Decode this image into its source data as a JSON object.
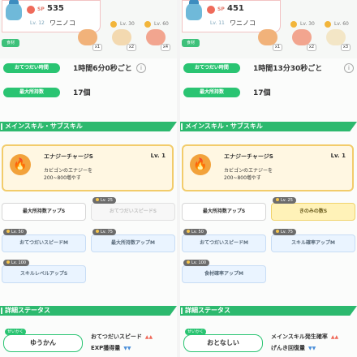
{
  "panels": [
    {
      "sp": "535",
      "sp_label": "SP",
      "level": "Lv. 12",
      "name": "ワニノコ",
      "green_tag": "食材",
      "items": [
        {
          "lv": "",
          "count": "x1",
          "color": "#f1b27a"
        },
        {
          "lv": "Lv. 30",
          "count": "x2",
          "color": "#f3d9b0"
        },
        {
          "lv": "Lv. 60",
          "count": "x4",
          "color": "#f2a58f"
        }
      ],
      "help_label": "おてつだい時間",
      "help_value": "1時間6分0秒ごと",
      "max_label": "最大所持数",
      "max_value": "17個",
      "section_skill": "メインスキル・サブスキル",
      "main_skill": {
        "name": "エナジーチャージS",
        "lv": "Lv. 1",
        "desc_1": "カビゴンのエナジーを",
        "desc_2": "200~800増やす"
      },
      "sub_skills": [
        {
          "tag": "",
          "label": "最大所持数アップS",
          "style": "white"
        },
        {
          "tag": "Lv. 25",
          "label": "おてつだいスピードS",
          "style": "gray"
        },
        {
          "tag": "Lv. 50",
          "label": "おてつだいスピードM",
          "style": "blue"
        },
        {
          "tag": "Lv. 75",
          "label": "最大所持数アップM",
          "style": "blue"
        },
        {
          "tag": "Lv. 100",
          "label": "スキルレベルアップS",
          "style": "blue"
        }
      ],
      "section_stats": "詳細ステータス",
      "personality_tag": "せいかく",
      "personality": "ゆうかん",
      "stats": [
        {
          "label": "おてつだいスピード",
          "arrow": "▲▲",
          "dir": "up"
        },
        {
          "label": "EXP獲得量",
          "arrow": "▼▼",
          "dir": "down"
        }
      ]
    },
    {
      "sp": "451",
      "sp_label": "SP",
      "level": "Lv. 11",
      "name": "ワニノコ",
      "green_tag": "食材",
      "items": [
        {
          "lv": "",
          "count": "x1",
          "color": "#f1b27a"
        },
        {
          "lv": "Lv. 30",
          "count": "x2",
          "color": "#f2a58f"
        },
        {
          "lv": "Lv. 60",
          "count": "x3",
          "color": "#f3e6c6"
        }
      ],
      "help_label": "おてつだい時間",
      "help_value": "1時間13分30秒ごと",
      "max_label": "最大所持数",
      "max_value": "17個",
      "section_skill": "メインスキル・サブスキル",
      "main_skill": {
        "name": "エナジーチャージS",
        "lv": "Lv. 1",
        "desc_1": "カビゴンのエナジーを",
        "desc_2": "200~800増やす"
      },
      "sub_skills": [
        {
          "tag": "",
          "label": "最大所持数アップS",
          "style": "white"
        },
        {
          "tag": "Lv. 25",
          "label": "きのみの数S",
          "style": "yellow"
        },
        {
          "tag": "Lv. 50",
          "label": "おてつだいスピードM",
          "style": "blue"
        },
        {
          "tag": "Lv. 75",
          "label": "スキル確率アップM",
          "style": "blue"
        },
        {
          "tag": "Lv. 100",
          "label": "食材確率アップM",
          "style": "blue"
        }
      ],
      "section_stats": "詳細ステータス",
      "personality_tag": "せいかく",
      "personality": "おとなしい",
      "stats": [
        {
          "label": "メインスキル発生確率",
          "arrow": "▲▲",
          "dir": "up"
        },
        {
          "label": "げんき回復量",
          "arrow": "▼▼",
          "dir": "down"
        }
      ]
    }
  ],
  "colors": {
    "green": "#2ac472",
    "section": "#2cb96e",
    "skill_border": "#f2cc6b"
  },
  "icons": {
    "info": "i",
    "flame": "flame-icon"
  }
}
